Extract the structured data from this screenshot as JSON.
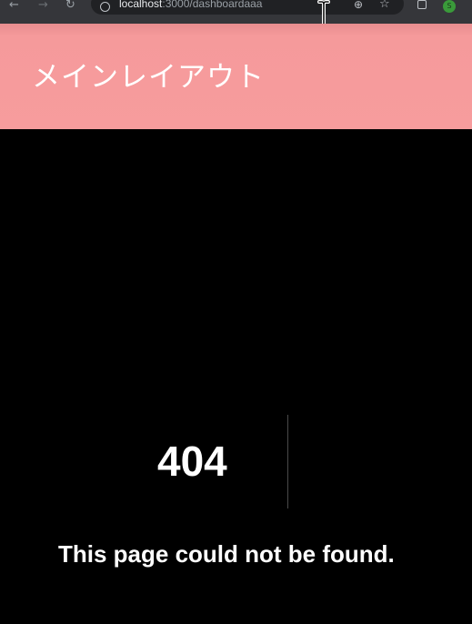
{
  "browser": {
    "url_host": "localhost",
    "url_path": ":3000/dashboardaaa",
    "back_icon": "arrow-left-icon",
    "forward_icon": "arrow-right-icon",
    "reload_icon": "reload-icon",
    "profile_initial": "S"
  },
  "header": {
    "title": "メインレイアウト",
    "background_color": "#f79c9d"
  },
  "error": {
    "code": "404",
    "message": "This page could not be found."
  }
}
